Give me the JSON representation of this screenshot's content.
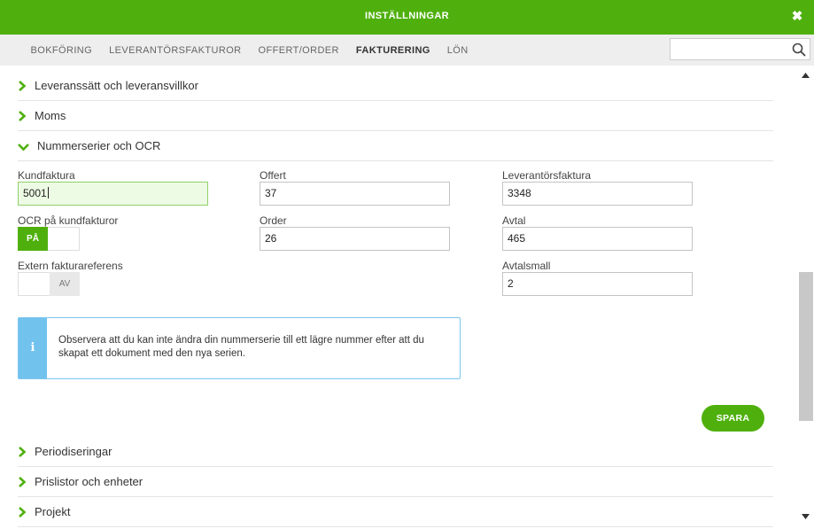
{
  "header": {
    "title": "INSTÄLLNINGAR",
    "close_label": "✖"
  },
  "tabs": [
    {
      "label": "BOKFÖRING",
      "active": false
    },
    {
      "label": "LEVERANTÖRSFAKTUROR",
      "active": false
    },
    {
      "label": "OFFERT/ORDER",
      "active": false
    },
    {
      "label": "FAKTURERING",
      "active": true
    },
    {
      "label": "LÖN",
      "active": false
    }
  ],
  "search": {
    "value": "",
    "placeholder": "",
    "icon": "search-icon"
  },
  "sections_top": [
    {
      "label": "Leveranssätt och leveransvillkor",
      "expanded": false
    },
    {
      "label": "Moms",
      "expanded": false
    },
    {
      "label": "Nummerserier och OCR",
      "expanded": true
    }
  ],
  "form": {
    "kundfaktura": {
      "label": "Kundfaktura",
      "value": "5001"
    },
    "offert": {
      "label": "Offert",
      "value": "37"
    },
    "leverantorsfaktura": {
      "label": "Leverantörsfaktura",
      "value": "3348"
    },
    "ocr": {
      "label": "OCR på kundfakturor",
      "state": "PÅ"
    },
    "order": {
      "label": "Order",
      "value": "26"
    },
    "avtal": {
      "label": "Avtal",
      "value": "465"
    },
    "extern": {
      "label": "Extern fakturareferens",
      "state": "AV"
    },
    "avtalsmall": {
      "label": "Avtalsmall",
      "value": "2"
    }
  },
  "info": {
    "icon": "info-icon",
    "text": "Observera att du kan inte ändra din nummerserie till ett lägre nummer efter att du skapat ett dokument med den nya serien."
  },
  "save_label": "SPARA",
  "sections_bottom": [
    {
      "label": "Periodiseringar",
      "expanded": false
    },
    {
      "label": "Prislistor och enheter",
      "expanded": false
    },
    {
      "label": "Projekt",
      "expanded": false
    }
  ],
  "colors": {
    "brand_green": "#4fb00d",
    "info_blue": "#72c2ee",
    "focus_bg": "#eefbe4"
  }
}
